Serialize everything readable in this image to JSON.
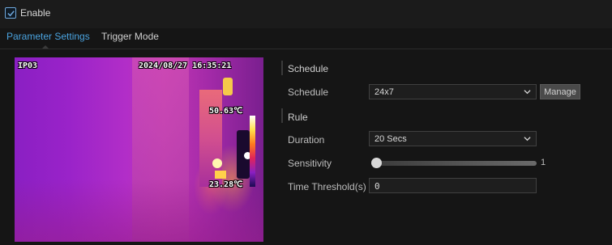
{
  "enable": {
    "label": "Enable",
    "checked": true
  },
  "tabs": [
    {
      "label": "Parameter Settings",
      "active": true
    },
    {
      "label": "Trigger Mode",
      "active": false
    }
  ],
  "video": {
    "camera": "IP03",
    "timestamp": "2024/08/27 16:35:21",
    "max_temp": "50.63℃",
    "min_temp": "23.28℃"
  },
  "schedule_section": {
    "title": "Schedule",
    "schedule_label": "Schedule",
    "schedule_value": "24x7",
    "manage_label": "Manage"
  },
  "rule_section": {
    "title": "Rule",
    "duration_label": "Duration",
    "duration_value": "20 Secs",
    "sensitivity_label": "Sensitivity",
    "sensitivity_value": "1",
    "time_threshold_label": "Time Threshold(s)",
    "time_threshold_value": "0"
  },
  "colors": {
    "accent": "#4aa3df",
    "background": "#151515"
  }
}
